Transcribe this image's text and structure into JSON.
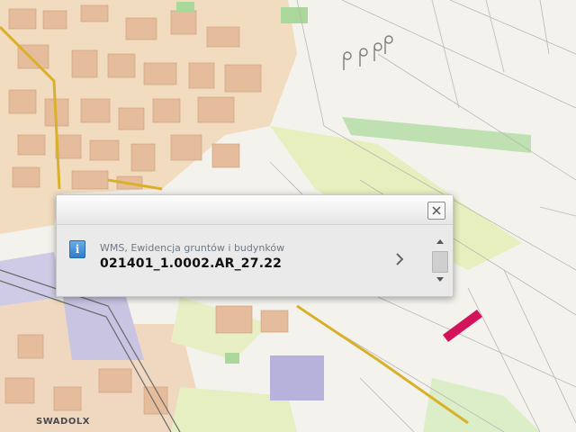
{
  "map": {
    "type": "cadastral-map",
    "place_label": "SWADOLX",
    "colors": {
      "background": "#f4f2ec",
      "urban_area": "#f0d7b8",
      "buildings": "#e3b999",
      "agricultural": "#e8efc2",
      "meadow": "#cfe6bb",
      "industrial": "#b9b6d9",
      "forest_green": "#9ed18f",
      "main_road": "#d9b02a",
      "highlighted_parcel": "#d4145a"
    }
  },
  "popup": {
    "layer_label": "WMS, Ewidencja gruntów i budynków",
    "feature_id": "021401_1.0002.AR_27.22",
    "info_icon": "info-icon",
    "close_icon": "close-icon",
    "next_icon": "chevron-right-icon"
  }
}
